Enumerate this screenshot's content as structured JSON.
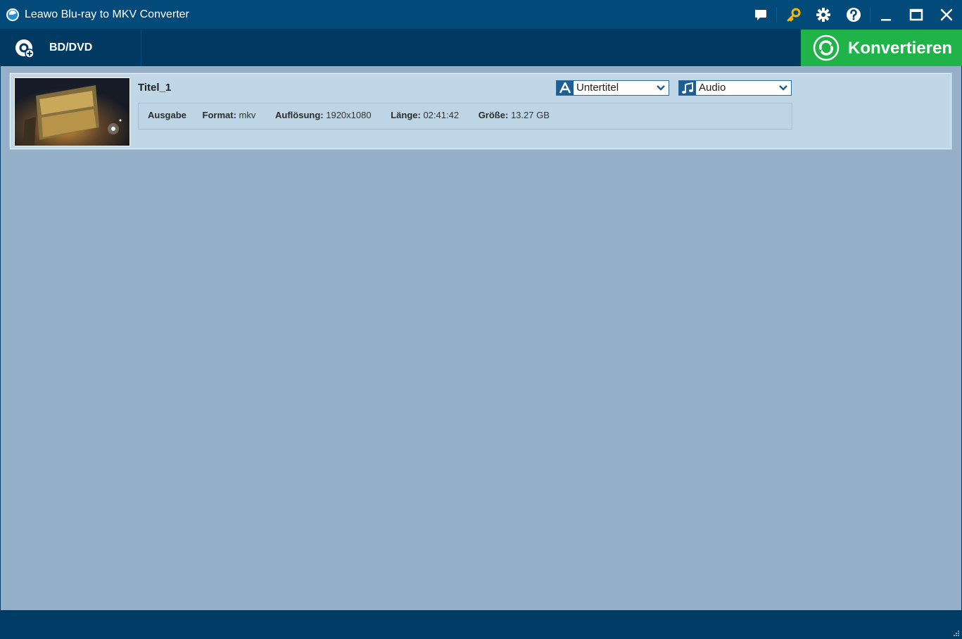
{
  "window": {
    "title": "Leawo Blu-ray to MKV Converter",
    "icons": [
      "app-logo-icon",
      "feedback-icon",
      "key-icon",
      "settings-icon",
      "help-icon",
      "minimize-icon",
      "maximize-icon",
      "close-icon"
    ]
  },
  "toolbar": {
    "source_label": "BD/DVD",
    "convert_label": "Konvertieren",
    "convert_color": "#1fb34a"
  },
  "titles": [
    {
      "name": "Titel_1",
      "subtitle_select": "Untertitel",
      "audio_select": "Audio",
      "info": {
        "output_label": "Ausgabe",
        "format_label": "Format:",
        "format_value": "mkv",
        "resolution_label": "Auflösung:",
        "resolution_value": "1920x1080",
        "length_label": "Länge:",
        "length_value": "02:41:42",
        "size_label": "Größe:",
        "size_value": "13.27 GB"
      }
    }
  ],
  "colors": {
    "titlebar": "#024a7a",
    "toolbar": "#003a63",
    "main_bg": "#94afc7",
    "item_bg": "#bfd7e6"
  }
}
